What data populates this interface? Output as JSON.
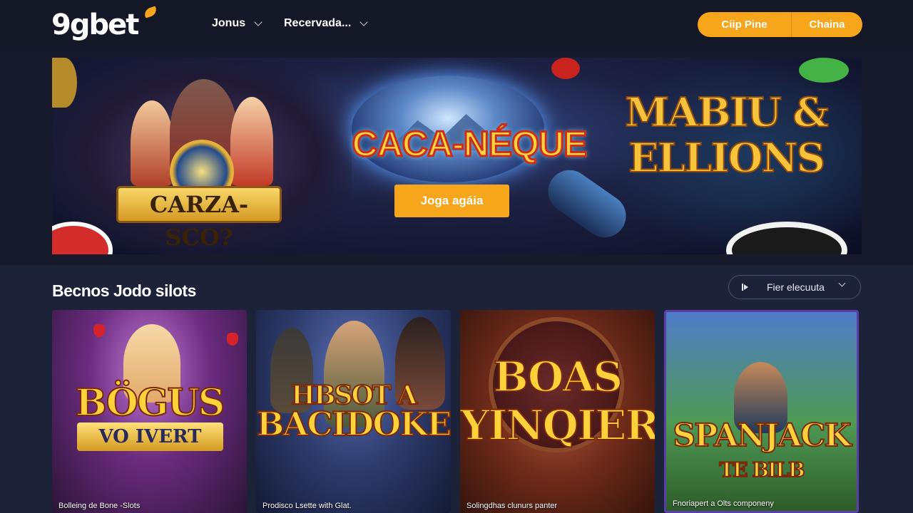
{
  "header": {
    "logo": "9gbet",
    "nav": [
      {
        "label": "Jonus"
      },
      {
        "label": "Recervada..."
      }
    ],
    "auth": {
      "left_label": "Ciip Pine",
      "right_label": "Chaina"
    }
  },
  "banner": {
    "left_sign": "CARZA-SCO?",
    "center_title": "CACA-NÉQUE",
    "right_title_line1": "MABIU &",
    "right_title_line2": "ELLIONS",
    "cta_label": "Joga agáia"
  },
  "section": {
    "title": "Becnos Jodo silots",
    "filter_label": "Fier elecuuta"
  },
  "games": [
    {
      "art_line1": "BÖGUS",
      "ribbon": "VO IVERT",
      "caption": "Bolleing de Bone -Slots"
    },
    {
      "art_line1": "HBSOT A",
      "art_line2": "BACIDOKE",
      "caption": "Prodisco Lsette with Glat."
    },
    {
      "art_line1": "BOAS",
      "art_line2": "YINQIER",
      "caption": "Solingdhas clunurs panter"
    },
    {
      "art_line1": "SPANJACK",
      "art_line2": "TE BILB",
      "caption": "Fnoriapert a Olts componeny"
    }
  ],
  "colors": {
    "accent": "#f7a51b",
    "background": "#161a2b",
    "section_bg": "#1c2238"
  }
}
